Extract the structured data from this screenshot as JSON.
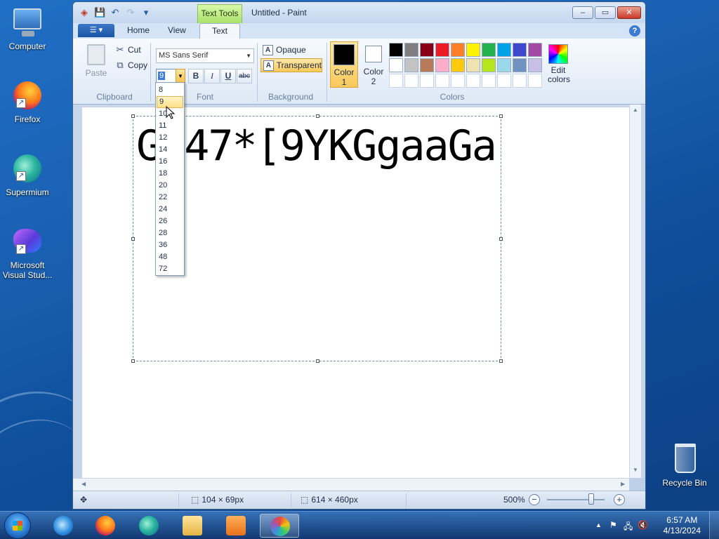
{
  "desktop": {
    "icons": [
      {
        "label": "Computer",
        "icon": "computer-icon"
      },
      {
        "label": "Firefox",
        "icon": "firefox-icon"
      },
      {
        "label": "Supermium",
        "icon": "supermium-icon"
      },
      {
        "label": "Microsoft Visual Stud...",
        "icon": "visual-studio-icon"
      },
      {
        "label": "Recycle Bin",
        "icon": "recycle-bin-icon"
      }
    ]
  },
  "window": {
    "title": "Untitled - Paint",
    "context_tab": "Text Tools",
    "quick_access": {
      "save": "💾",
      "undo": "↶",
      "redo": "↷",
      "customize": "▾"
    },
    "controls": {
      "minimize": "–",
      "maximize": "▭",
      "close": "✕"
    }
  },
  "ribbon": {
    "file_menu_glyph": "☰ ▾",
    "tabs": {
      "home": "Home",
      "view": "View",
      "text": "Text"
    },
    "help": "?",
    "clipboard": {
      "label": "Clipboard",
      "paste": "Paste",
      "cut": "Cut",
      "copy": "Copy",
      "cut_glyph": "✂",
      "copy_glyph": "⧉"
    },
    "font": {
      "label": "Font",
      "family": "MS Sans Serif",
      "size": "9",
      "bold": "B",
      "italic": "I",
      "underline": "U",
      "strikethrough": "abc"
    },
    "background": {
      "label": "Background",
      "opaque": "Opaque",
      "transparent": "Transparent",
      "mode_glyph": "A"
    },
    "colors": {
      "label": "Colors",
      "color1_label": "Color",
      "color1_num": "1",
      "color2_label": "Color",
      "color2_num": "2",
      "color1_value": "#000000",
      "color2_value": "#ffffff",
      "edit_label": "Edit",
      "edit_label2": "colors",
      "palette": [
        "#000000",
        "#7f7f7f",
        "#880015",
        "#ed1c24",
        "#ff7f27",
        "#fff200",
        "#22b14c",
        "#00a2e8",
        "#3f48cc",
        "#a349a4",
        "#ffffff",
        "#c3c3c3",
        "#b97a57",
        "#ffaec9",
        "#ffc90e",
        "#efe4b0",
        "#b5e61d",
        "#99d9ea",
        "#7092be",
        "#c8bfe7",
        "#ffffff",
        "#ffffff",
        "#ffffff",
        "#ffffff",
        "#ffffff",
        "#ffffff",
        "#ffffff",
        "#ffffff",
        "#ffffff",
        "#ffffff"
      ]
    }
  },
  "canvas": {
    "text": "G 47*[9YKGgaaGa"
  },
  "size_dropdown": {
    "options": [
      "8",
      "9",
      "10",
      "11",
      "12",
      "14",
      "16",
      "18",
      "20",
      "22",
      "24",
      "26",
      "28",
      "36",
      "48",
      "72"
    ],
    "highlighted": "9"
  },
  "statusbar": {
    "move_glyph": "✥",
    "selection_size": "104 × 69px",
    "canvas_size": "614 × 460px",
    "zoom": "500%",
    "zoom_out": "−",
    "zoom_in": "+"
  },
  "taskbar": {
    "time": "6:57 AM",
    "date": "4/13/2024",
    "tray_up": "▲",
    "tray_flag": "⚑",
    "tray_network": "🖧",
    "tray_volume": "🔇"
  }
}
